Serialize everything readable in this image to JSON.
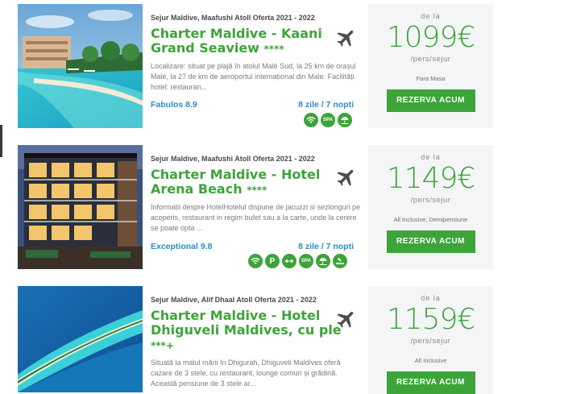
{
  "offers": [
    {
      "subtitle": "Sejur Maldive, Maafushi Atoll Oferta 2021 - 2022",
      "title": "Charter Maldive - Kaani Grand Seaview",
      "stars": "****",
      "description": "Localizare: situat pe plajă în atolul Malé Sud, la 25 km de orașul Malé, la 27 de km de aeroportul internațional din Male. Facilități hotel: restauran...",
      "rating": "Fabulos 8.9",
      "duration": "8 zile / 7 nopti",
      "facilities": [
        "wifi-icon",
        "spa-icon",
        "beach-icon"
      ],
      "price_prefix": "de la",
      "price": "1099€",
      "price_unit": "/pers/sejur",
      "meal_plan": "Fara Masa",
      "cta": "REZERVA ACUM"
    },
    {
      "subtitle": "Sejur Maldive, Maafushi Atoll Oferta 2021 - 2022",
      "title": "Charter Maldive - Hotel Arena Beach",
      "stars": "****",
      "description": "Informatii despre HotelHotelul dispune de jacuzzi si sezlonguri pe acoperis, restaurant in regim bufet sau a la carte, unde la cerere se poate opta ...",
      "rating": "Exceptional 9.8",
      "duration": "8 zile / 7 nopti",
      "facilities": [
        "wifi-icon",
        "parking-icon",
        "fitness-icon",
        "spa-icon",
        "beach-icon",
        "pool-icon"
      ],
      "price_prefix": "de la",
      "price": "1149€",
      "price_unit": "/pers/sejur",
      "meal_plan": "All Inclusive, Demipensiune",
      "cta": "REZERVA ACUM"
    },
    {
      "subtitle": "Sejur Maldive, Alif Dhaal Atoll Oferta 2021 - 2022",
      "title": "Charter Maldive - Hotel Dhiguveli Maldives, cu ple",
      "stars": "***+",
      "description": "Situată la malul mării în Dhigurah, Dhiguveli Maldives oferă cazare de 3 stele, cu restaurant, lounge comun și grădină. Această pensiune de 3 stele ar...",
      "price_prefix": "de la",
      "price": "1159€",
      "price_unit": "/pers/sejur",
      "meal_plan": "All Inclusive",
      "cta": "REZERVA ACUM"
    }
  ],
  "labels": {
    "spa": "SPA",
    "parking": "P"
  },
  "colors": {
    "accent": "#3da43a",
    "link": "#2e8ac8",
    "price_bg": "#f4f5f6"
  }
}
